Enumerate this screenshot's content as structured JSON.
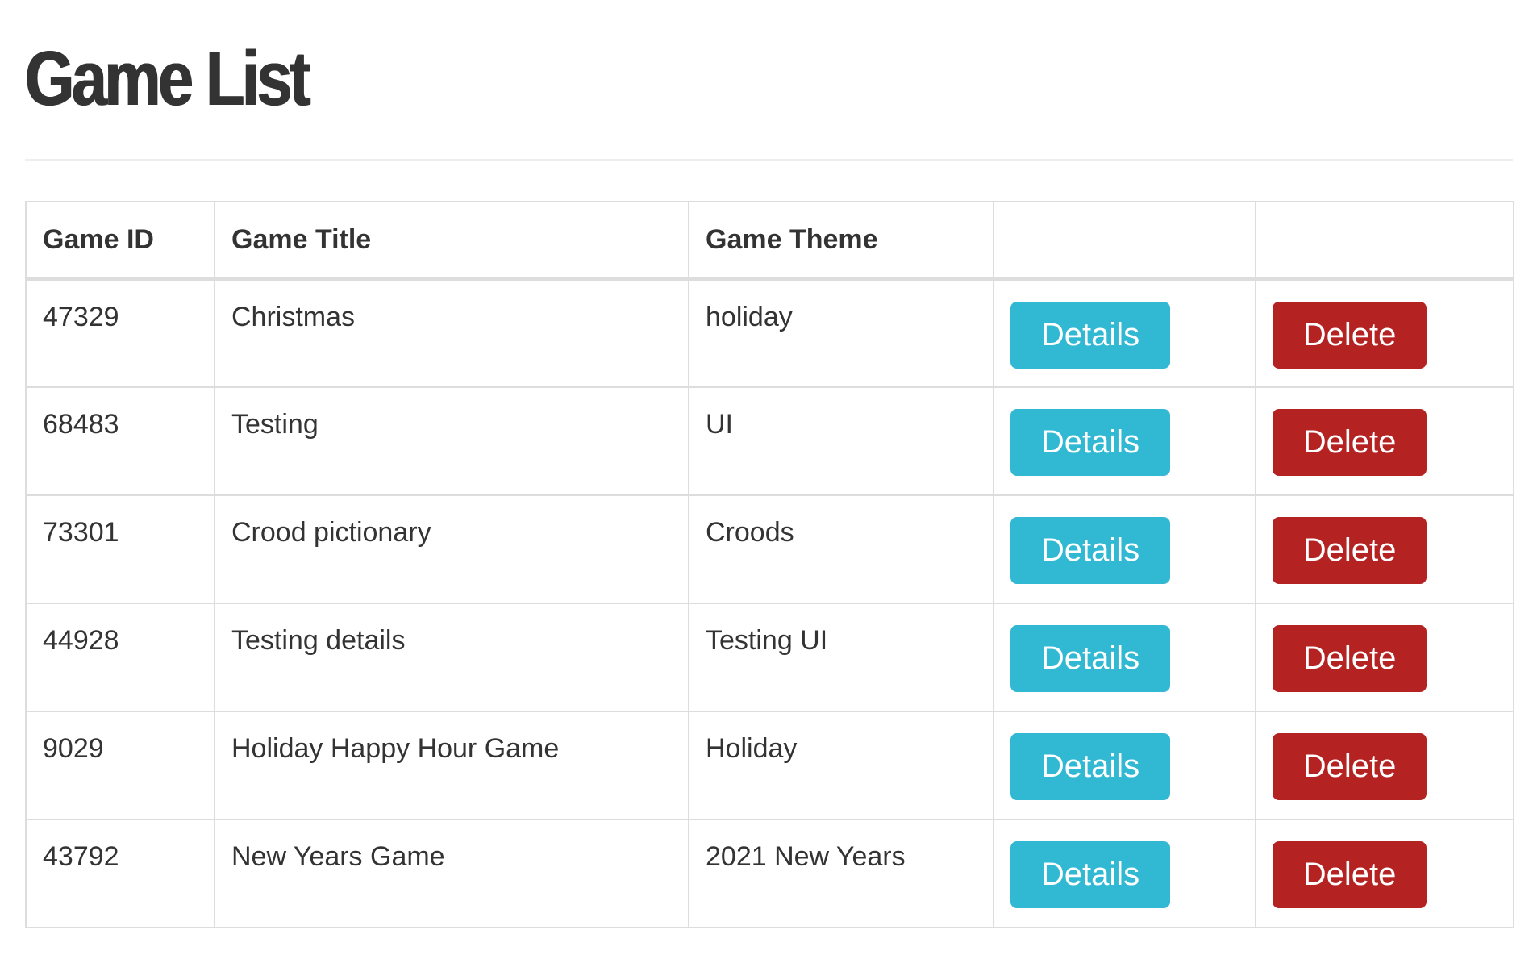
{
  "page": {
    "title": "Game List"
  },
  "table": {
    "headers": {
      "id": "Game ID",
      "title": "Game Title",
      "theme": "Game Theme",
      "details": "",
      "delete": ""
    },
    "rows": [
      {
        "id": "47329",
        "title": "Christmas",
        "theme": "holiday",
        "details_label": "Details",
        "delete_label": "Delete"
      },
      {
        "id": "68483",
        "title": "Testing",
        "theme": "UI",
        "details_label": "Details",
        "delete_label": "Delete"
      },
      {
        "id": "73301",
        "title": "Crood pictionary",
        "theme": "Croods",
        "details_label": "Details",
        "delete_label": "Delete"
      },
      {
        "id": "44928",
        "title": "Testing details",
        "theme": "Testing UI",
        "details_label": "Details",
        "delete_label": "Delete"
      },
      {
        "id": "9029",
        "title": "Holiday Happy Hour Game",
        "theme": "Holiday",
        "details_label": "Details",
        "delete_label": "Delete"
      },
      {
        "id": "43792",
        "title": "New Years Game",
        "theme": "2021 New Years",
        "details_label": "Details",
        "delete_label": "Delete"
      }
    ]
  },
  "colors": {
    "details_button": "#31b8d3",
    "delete_button": "#b52222",
    "text": "#333333",
    "border": "#dddddd"
  }
}
